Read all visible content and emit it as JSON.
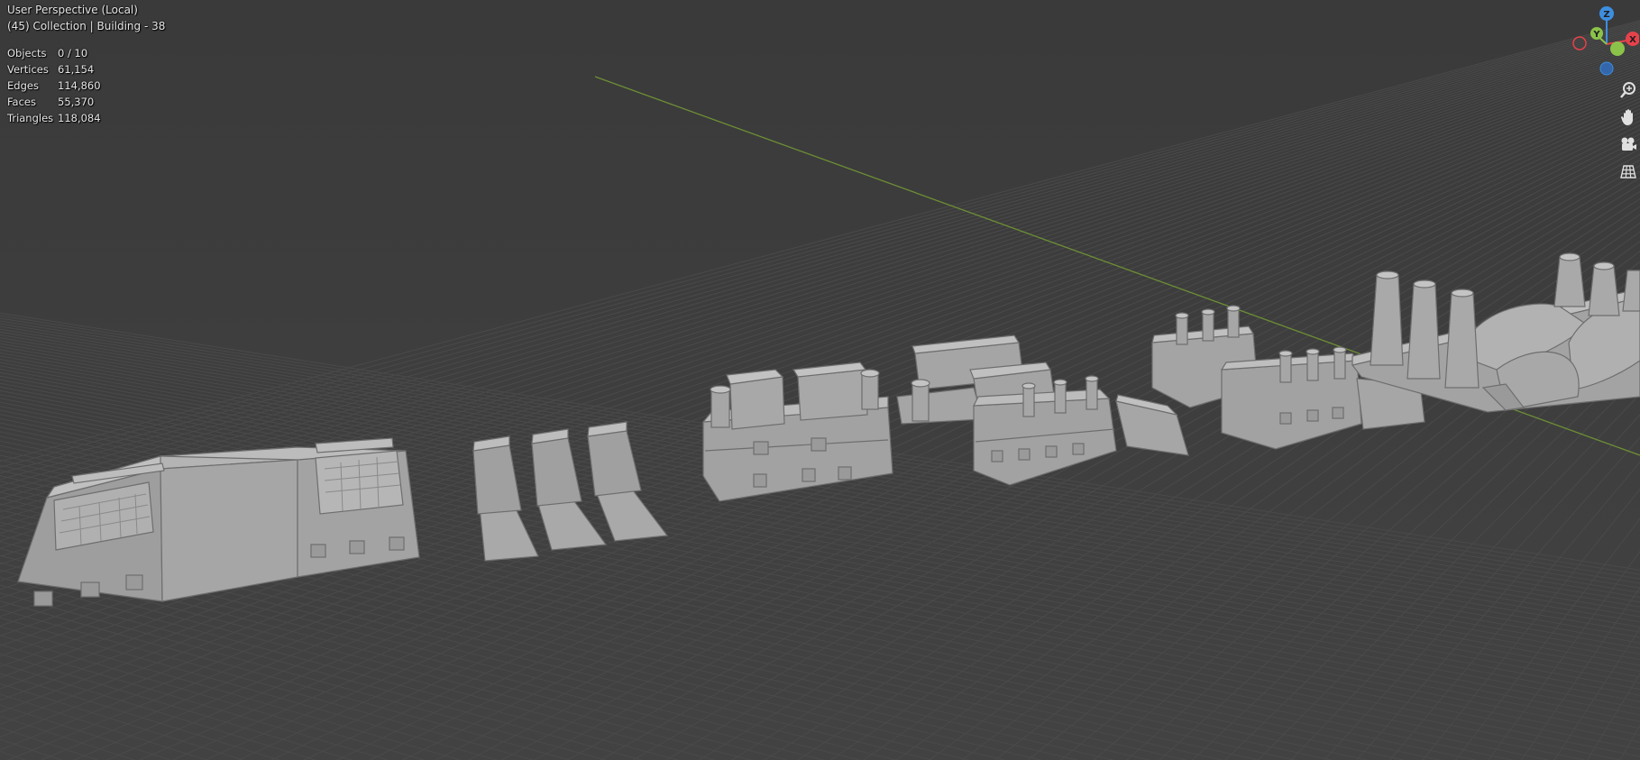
{
  "viewport": {
    "title": "User Perspective (Local)",
    "collection_line": "(45) Collection | Building - 38",
    "stats": [
      {
        "label": "Objects",
        "value": "0 / 10"
      },
      {
        "label": "Vertices",
        "value": "61,154"
      },
      {
        "label": "Edges",
        "value": "114,860"
      },
      {
        "label": "Faces",
        "value": "55,370"
      },
      {
        "label": "Triangles",
        "value": "118,084"
      }
    ]
  },
  "gizmo": {
    "axis_x_label": "X",
    "axis_y_label": "Y",
    "axis_z_label": "Z",
    "colors": {
      "x": "#e6424b",
      "y": "#8bc34a",
      "z": "#3d8ee0"
    }
  },
  "nav_buttons": [
    {
      "name": "zoom-icon"
    },
    {
      "name": "hand-pan-icon"
    },
    {
      "name": "camera-icon"
    },
    {
      "name": "grid-ortho-icon"
    }
  ],
  "colors": {
    "background": "#3d3d3d",
    "grid_line": "#474747",
    "axis_y_line": "#6d8f35",
    "mesh": "#a8a8a8"
  }
}
